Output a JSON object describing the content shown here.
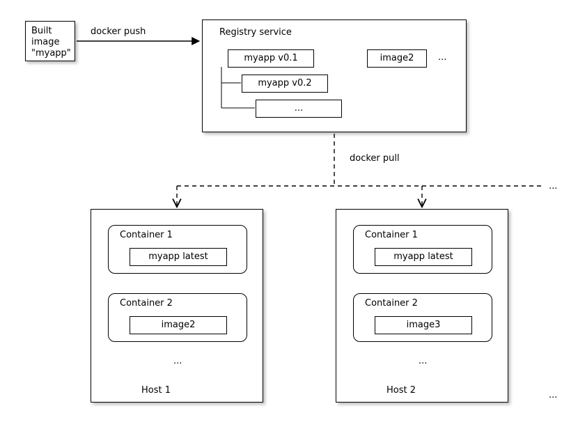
{
  "built_image": {
    "line1": "Built",
    "line2": "image",
    "line3": "\"myapp\""
  },
  "push_label": "docker push",
  "pull_label": "docker pull",
  "registry": {
    "title": "Registry service",
    "myapp_v01": "myapp v0.1",
    "myapp_v02": "myapp v0.2",
    "myapp_more": "...",
    "image2": "image2",
    "more": "..."
  },
  "hosts_more": "...",
  "host1": {
    "title": "Host 1",
    "c1_title": "Container 1",
    "c1_image": "myapp latest",
    "c2_title": "Container 2",
    "c2_image": "image2",
    "more": "..."
  },
  "host2": {
    "title": "Host 2",
    "c1_title": "Container 1",
    "c1_image": "myapp latest",
    "c2_title": "Container 2",
    "c2_image": "image3",
    "more": "..."
  },
  "bottom_more": "..."
}
